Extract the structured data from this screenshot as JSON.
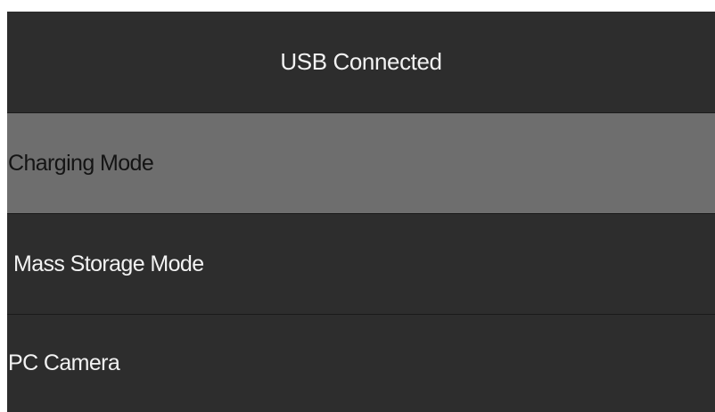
{
  "header": {
    "title": "USB Connected"
  },
  "menu": {
    "items": [
      {
        "label": "Charging Mode",
        "selected": true
      },
      {
        "label": "Mass Storage Mode",
        "selected": false
      },
      {
        "label": "PC Camera",
        "selected": false
      }
    ]
  },
  "colors": {
    "background": "#2d2d2d",
    "selected_background": "#6e6e6e",
    "text": "#f2f2f2",
    "selected_text": "#141414",
    "divider": "#1a1a1a"
  }
}
